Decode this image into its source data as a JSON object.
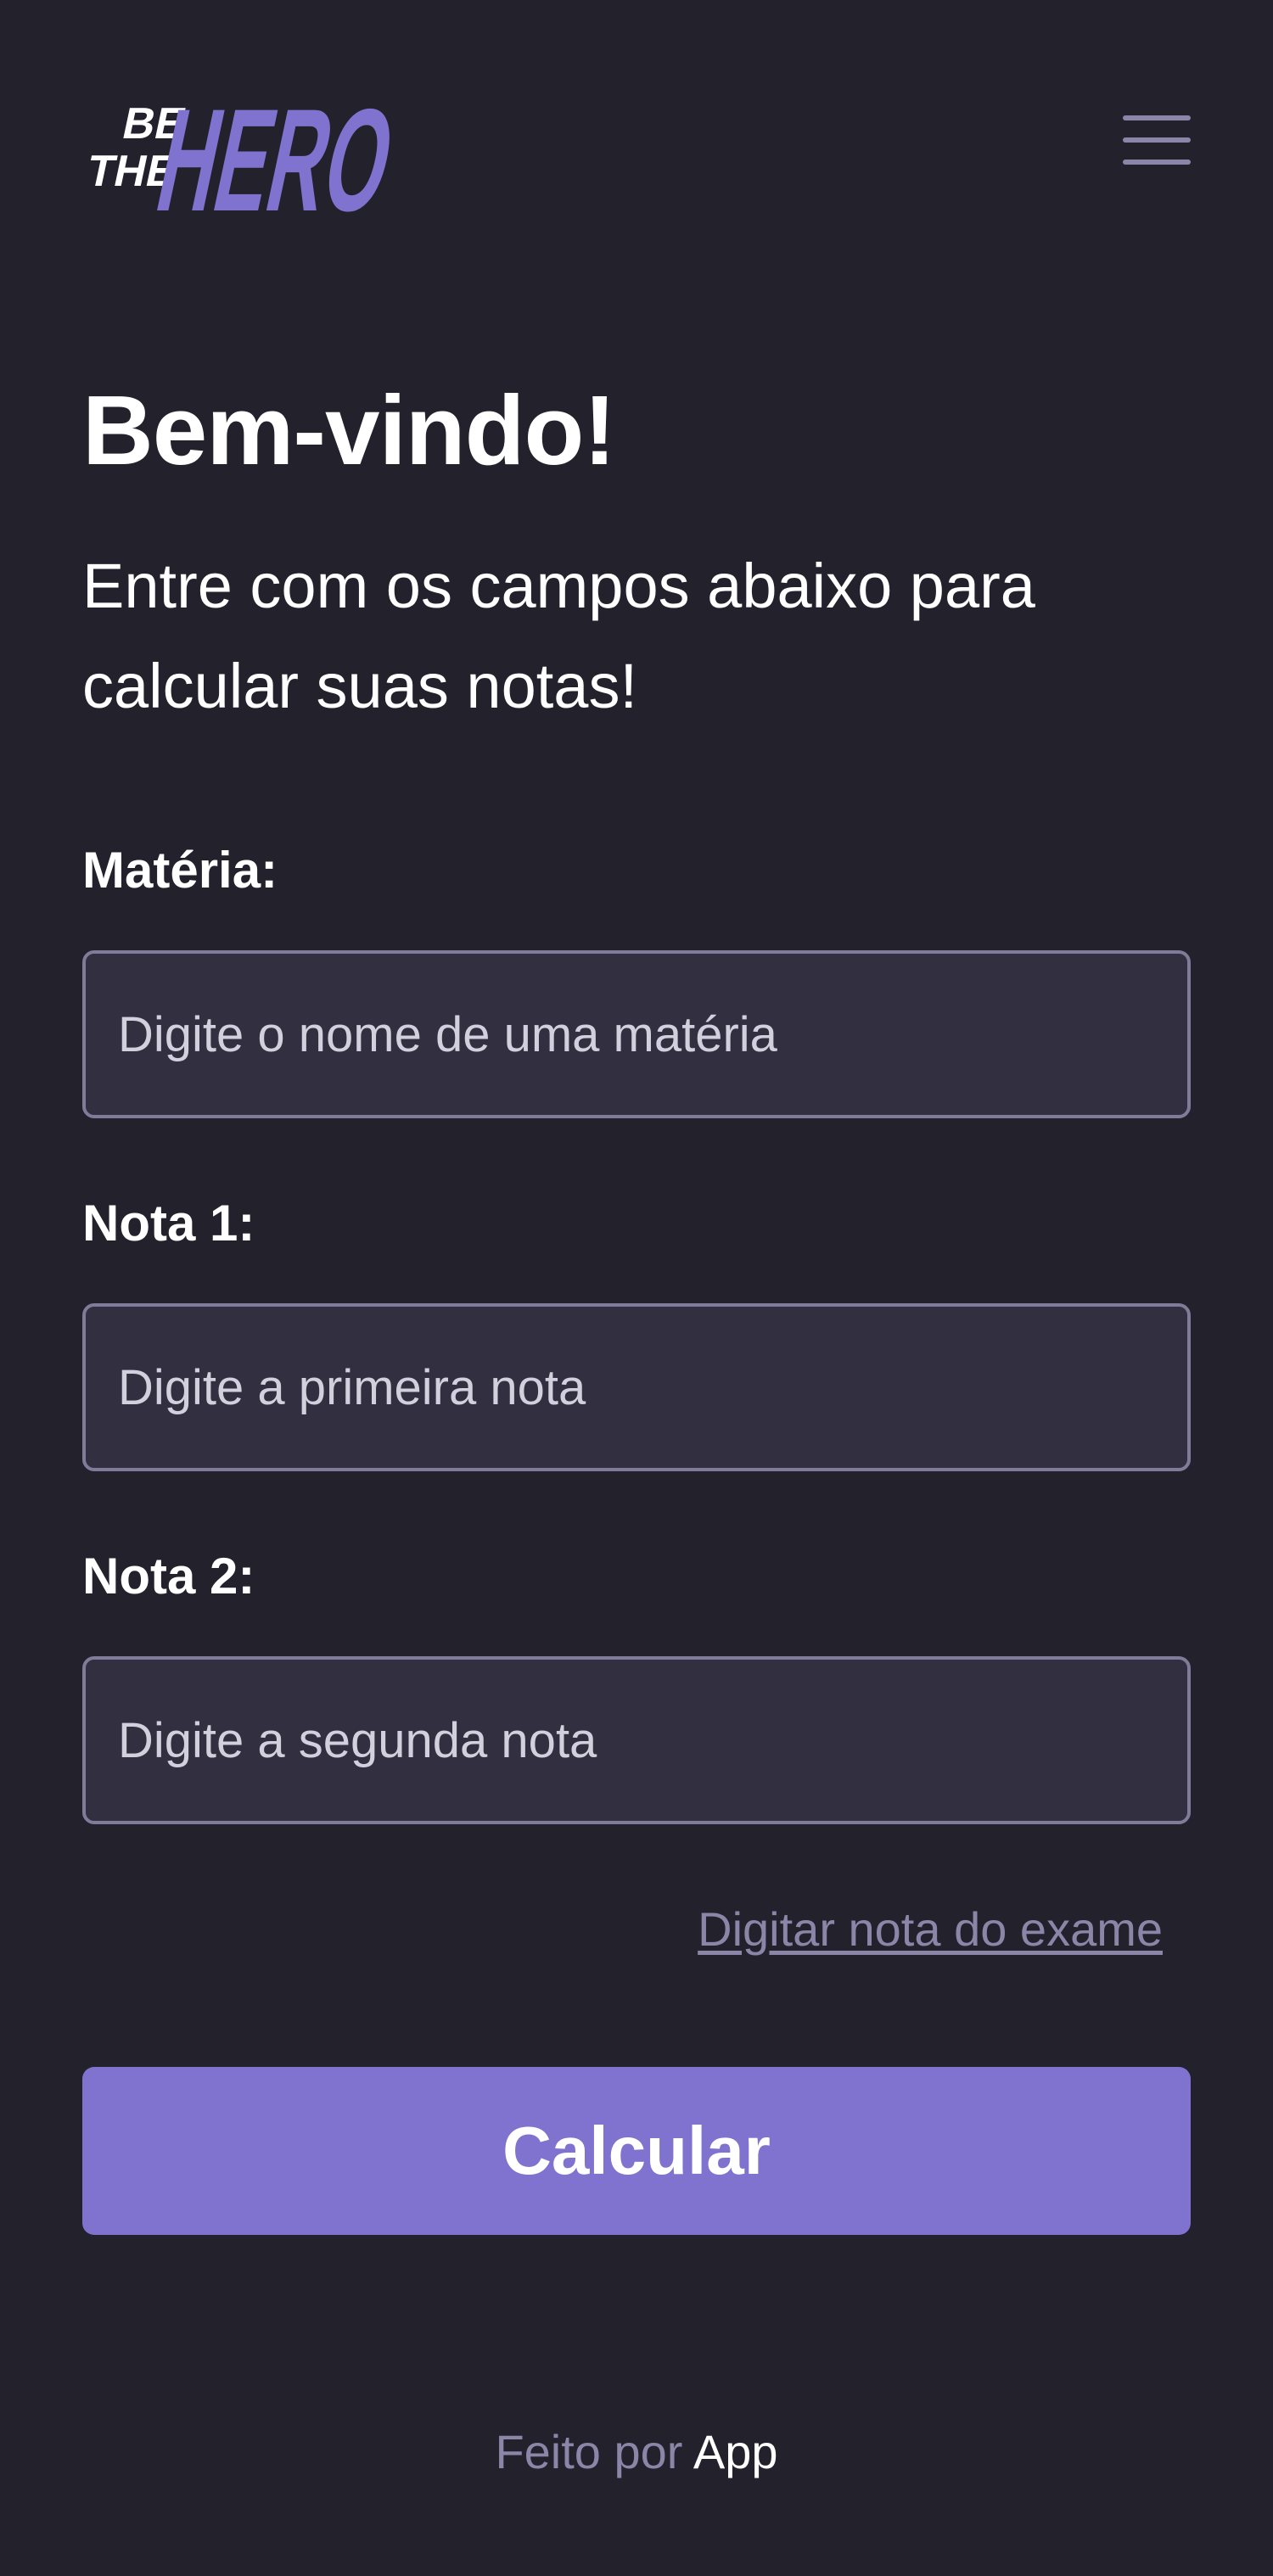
{
  "header": {
    "logo_text_small_1": "BE",
    "logo_text_small_2": "THE",
    "logo_text_big": "HERO",
    "menu_icon": "hamburger-menu-icon"
  },
  "main": {
    "title": "Bem-vindo!",
    "subtitle": "Entre com os campos abaixo para calcular suas notas!"
  },
  "form": {
    "subject": {
      "label": "Matéria:",
      "placeholder": "Digite o nome de uma matéria",
      "value": ""
    },
    "grade1": {
      "label": "Nota 1:",
      "placeholder": "Digite a primeira nota",
      "value": ""
    },
    "grade2": {
      "label": "Nota 2:",
      "placeholder": "Digite a segunda nota",
      "value": ""
    },
    "exam_link": "Digitar nota do exame",
    "submit_label": "Calcular"
  },
  "footer": {
    "prefix": "Feito por",
    "author": "App"
  },
  "colors": {
    "background": "#22212c",
    "accent": "#8073cf",
    "input_background": "#312f40",
    "input_border": "#7f7b98",
    "muted_text": "#8b86a8"
  }
}
